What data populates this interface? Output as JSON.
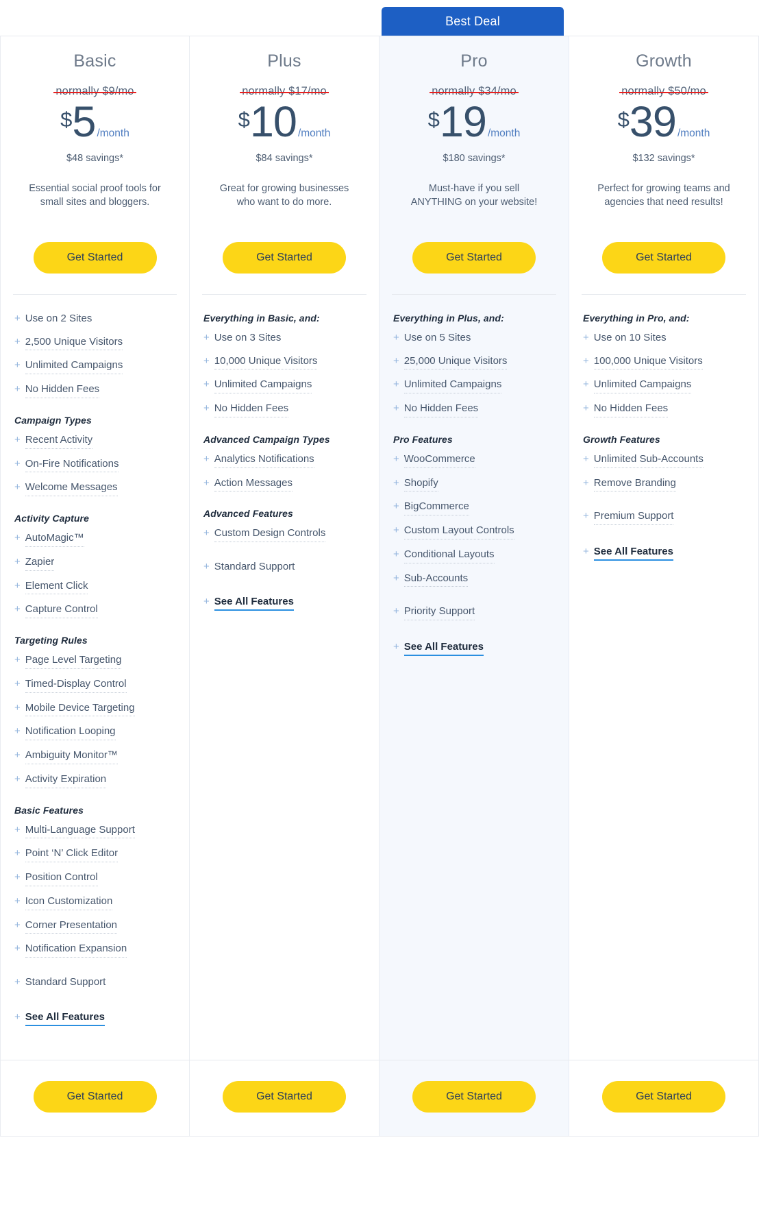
{
  "badge": {
    "label": "Best Deal"
  },
  "cta_label": "Get Started",
  "plans": [
    {
      "name": "Basic",
      "old_price": "normally $9/mo",
      "currency": "$",
      "amount": "5",
      "per": "/month",
      "savings": "$48 savings*",
      "blurb": "Essential social proof tools for small sites and bloggers.",
      "featured": false,
      "sections": [
        {
          "title": "",
          "items": [
            {
              "label": "Use on 2 Sites",
              "dotted": false
            },
            {
              "label": "2,500 Unique Visitors",
              "dotted": true
            },
            {
              "label": "Unlimited Campaigns",
              "dotted": true
            },
            {
              "label": "No Hidden Fees",
              "dotted": true
            }
          ]
        },
        {
          "title": "Campaign Types",
          "items": [
            {
              "label": "Recent Activity",
              "dotted": true
            },
            {
              "label": "On-Fire Notifications",
              "dotted": true
            },
            {
              "label": "Welcome Messages",
              "dotted": true
            }
          ]
        },
        {
          "title": "Activity Capture",
          "items": [
            {
              "label": "AutoMagic™",
              "dotted": true
            },
            {
              "label": "Zapier",
              "dotted": true
            },
            {
              "label": "Element Click",
              "dotted": true
            },
            {
              "label": "Capture Control",
              "dotted": true
            }
          ]
        },
        {
          "title": "Targeting Rules",
          "items": [
            {
              "label": "Page Level Targeting",
              "dotted": true
            },
            {
              "label": "Timed-Display Control",
              "dotted": true
            },
            {
              "label": "Mobile Device Targeting",
              "dotted": true
            },
            {
              "label": "Notification Looping",
              "dotted": true
            },
            {
              "label": "Ambiguity Monitor™",
              "dotted": true
            },
            {
              "label": "Activity Expiration",
              "dotted": true
            }
          ]
        },
        {
          "title": "Basic Features",
          "items": [
            {
              "label": "Multi-Language Support",
              "dotted": true
            },
            {
              "label": "Point ‘N’ Click Editor",
              "dotted": true
            },
            {
              "label": "Position Control",
              "dotted": true
            },
            {
              "label": "Icon Customization",
              "dotted": true
            },
            {
              "label": "Corner Presentation",
              "dotted": true
            },
            {
              "label": "Notification Expansion",
              "dotted": true
            },
            {
              "label": "Standard Support",
              "dotted": false,
              "gap": true
            }
          ]
        }
      ],
      "see_all": "See All Features"
    },
    {
      "name": "Plus",
      "old_price": "normally $17/mo",
      "currency": "$",
      "amount": "10",
      "per": "/month",
      "savings": "$84 savings*",
      "blurb": "Great for growing businesses who want to do more.",
      "featured": false,
      "sections": [
        {
          "title": "Everything in Basic, and:",
          "items": [
            {
              "label": "Use on 3 Sites",
              "dotted": false
            },
            {
              "label": "10,000 Unique Visitors",
              "dotted": true
            },
            {
              "label": "Unlimited Campaigns",
              "dotted": true
            },
            {
              "label": "No Hidden Fees",
              "dotted": true
            }
          ]
        },
        {
          "title": "Advanced Campaign Types",
          "items": [
            {
              "label": "Analytics Notifications",
              "dotted": true
            },
            {
              "label": "Action Messages",
              "dotted": true
            }
          ]
        },
        {
          "title": "Advanced Features",
          "items": [
            {
              "label": "Custom Design Controls",
              "dotted": true
            },
            {
              "label": "Standard Support",
              "dotted": false,
              "gap": true
            }
          ]
        }
      ],
      "see_all": "See All Features"
    },
    {
      "name": "Pro",
      "old_price": "normally $34/mo",
      "currency": "$",
      "amount": "19",
      "per": "/month",
      "savings": "$180 savings*",
      "blurb": "Must-have if you sell ANYTHING on your website!",
      "featured": true,
      "sections": [
        {
          "title": "Everything in Plus, and:",
          "items": [
            {
              "label": "Use on 5 Sites",
              "dotted": false
            },
            {
              "label": "25,000 Unique Visitors",
              "dotted": true
            },
            {
              "label": "Unlimited Campaigns",
              "dotted": true
            },
            {
              "label": "No Hidden Fees",
              "dotted": true
            }
          ]
        },
        {
          "title": "Pro Features",
          "items": [
            {
              "label": "WooCommerce",
              "dotted": true
            },
            {
              "label": "Shopify",
              "dotted": true
            },
            {
              "label": "BigCommerce",
              "dotted": true
            },
            {
              "label": "Custom Layout Controls",
              "dotted": true
            },
            {
              "label": "Conditional Layouts",
              "dotted": true
            },
            {
              "label": "Sub-Accounts",
              "dotted": true
            },
            {
              "label": "Priority Support",
              "dotted": true,
              "gap": true
            }
          ]
        }
      ],
      "see_all": "See All Features"
    },
    {
      "name": "Growth",
      "old_price": "normally $50/mo",
      "currency": "$",
      "amount": "39",
      "per": "/month",
      "savings": "$132 savings*",
      "blurb": "Perfect for growing teams and agencies that need results!",
      "featured": false,
      "sections": [
        {
          "title": "Everything in Pro, and:",
          "items": [
            {
              "label": "Use on 10 Sites",
              "dotted": false
            },
            {
              "label": "100,000 Unique Visitors",
              "dotted": true
            },
            {
              "label": "Unlimited Campaigns",
              "dotted": true
            },
            {
              "label": "No Hidden Fees",
              "dotted": true
            }
          ]
        },
        {
          "title": "Growth Features",
          "items": [
            {
              "label": "Unlimited Sub-Accounts",
              "dotted": true
            },
            {
              "label": "Remove Branding",
              "dotted": true
            },
            {
              "label": "Premium Support",
              "dotted": true,
              "gap": true
            }
          ]
        }
      ],
      "see_all": "See All Features"
    }
  ]
}
